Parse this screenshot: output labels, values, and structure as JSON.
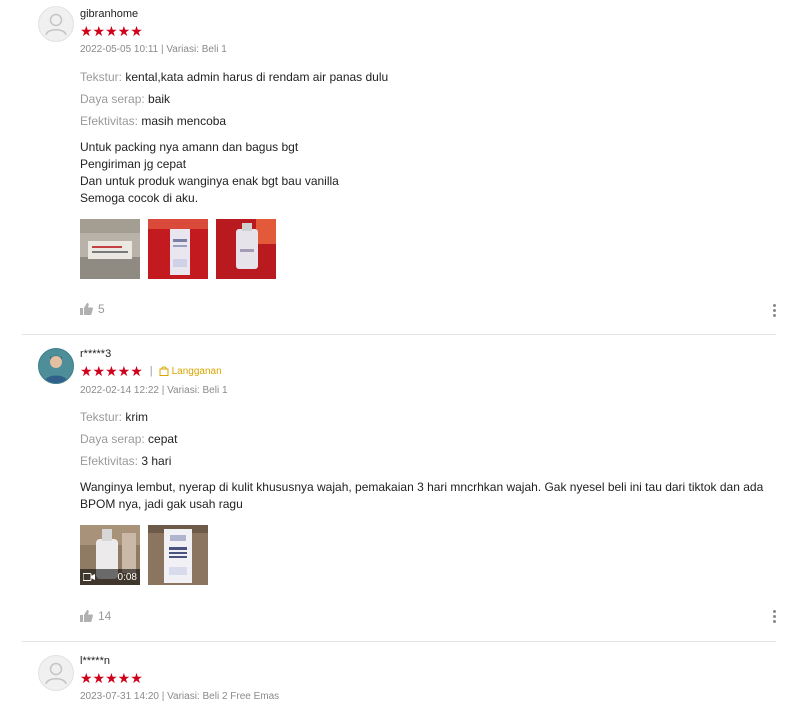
{
  "reviews": [
    {
      "username": "gibranhome",
      "rating": 5,
      "stars": "★★★★★",
      "date_variation": "2022-05-05 10:11 | Variasi: Beli 1",
      "attributes": [
        {
          "label": "Tekstur:",
          "value": "kental,kata admin harus di rendam air panas dulu"
        },
        {
          "label": "Daya serap:",
          "value": "baik"
        },
        {
          "label": "Efektivitas:",
          "value": "masih mencoba"
        }
      ],
      "body_lines": [
        "Untuk packing nya amann dan bagus bgt",
        "Pengiriman jg cepat",
        "Dan untuk produk wanginya enak bgt bau vanilla",
        "Semoga cocok di aku."
      ],
      "likes": "5"
    },
    {
      "username": "r*****3",
      "rating": 5,
      "stars": "★★★★★",
      "separator": "|",
      "badge": "Langganan",
      "date_variation": "2022-02-14 12:22 | Variasi: Beli 1",
      "attributes": [
        {
          "label": "Tekstur:",
          "value": "krim"
        },
        {
          "label": "Daya serap:",
          "value": "cepat"
        },
        {
          "label": "Efektivitas:",
          "value": "3 hari"
        }
      ],
      "body": "Wanginya lembut, nyerap di kulit khususnya wajah, pemakaian 3 hari mncrhkan wajah. Gak nyesel beli ini tau dari tiktok dan ada BPOM nya, jadi gak usah ragu",
      "video_duration": "0:08",
      "likes": "14"
    },
    {
      "username": "l*****n",
      "rating": 5,
      "stars": "★★★★★",
      "date_variation": "2023-07-31 14:20 | Variasi: Beli 2 Free Emas"
    }
  ],
  "colors": {
    "star": "#d0011b",
    "badge": "#d9a400",
    "muted": "#9a9a9a"
  },
  "icons": [
    "user-avatar-placeholder-icon",
    "thumbs-up-icon",
    "more-vertical-icon",
    "shopping-bag-icon",
    "video-camera-icon"
  ]
}
